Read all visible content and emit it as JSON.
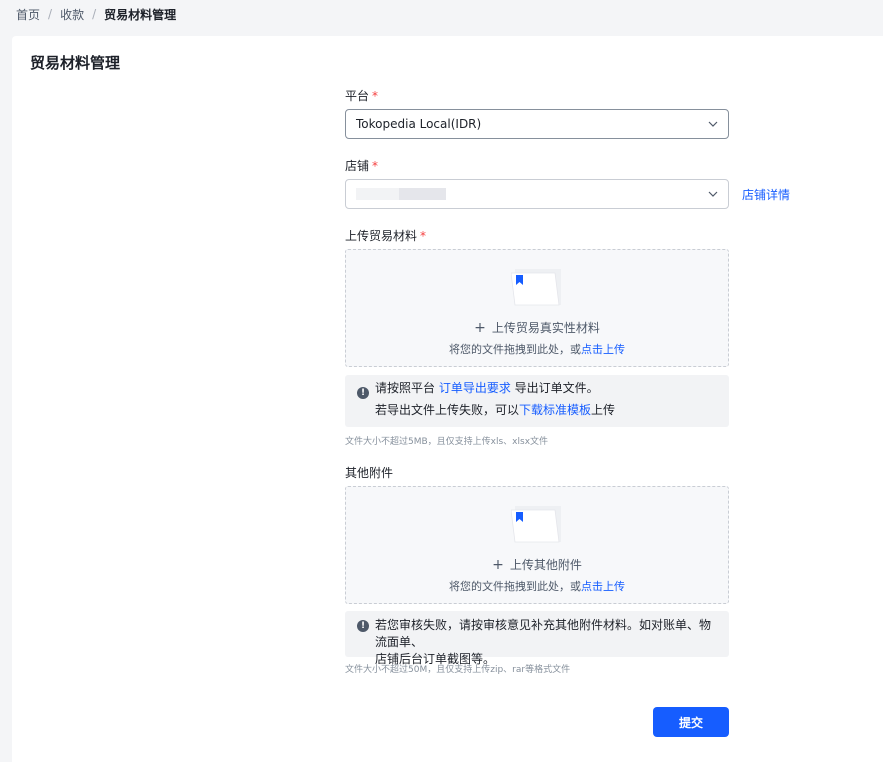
{
  "breadcrumb": {
    "items": [
      "首页",
      "收款",
      "贸易材料管理"
    ],
    "separator": "/"
  },
  "page": {
    "title": "贸易材料管理"
  },
  "form": {
    "platform": {
      "label": "平台",
      "required_mark": "*",
      "value": "Tokopedia Local(IDR)"
    },
    "store": {
      "label": "店铺",
      "required_mark": "*",
      "detail_link": "店铺详情"
    },
    "trade_upload": {
      "label": "上传贸易材料",
      "required_mark": "*",
      "title": "上传贸易真实性材料",
      "hint_prefix": "将您的文件拖拽到此处，或",
      "hint_link": "点击上传",
      "notice": {
        "line1_prefix": "请按照平台 ",
        "line1_link": "订单导出要求",
        "line1_suffix": " 导出订单文件。",
        "line2_prefix": "若导出文件上传失败，可以",
        "line2_link": "下载标准模板",
        "line2_suffix": "上传"
      },
      "size_tip": "文件大小不超过5MB，且仅支持上传xls、xlsx文件"
    },
    "other_upload": {
      "label": "其他附件",
      "title": "上传其他附件",
      "hint_prefix": "将您的文件拖拽到此处，或",
      "hint_link": "点击上传",
      "notice_line1": "若您审核失败，请按审核意见补充其他附件材料。如对账单、物流面单、",
      "notice_line2": "店铺后台订单截图等。",
      "size_tip": "文件大小不超过50M，且仅支持上传zip、rar等格式文件"
    },
    "submit_label": "提交"
  },
  "icons": {
    "dropdown": "chevron-down-icon",
    "upload": "folder-upload-icon",
    "info": "info-icon"
  },
  "colors": {
    "primary": "#165dff",
    "required": "#f53f3f",
    "page_bg": "#f4f5f7"
  }
}
